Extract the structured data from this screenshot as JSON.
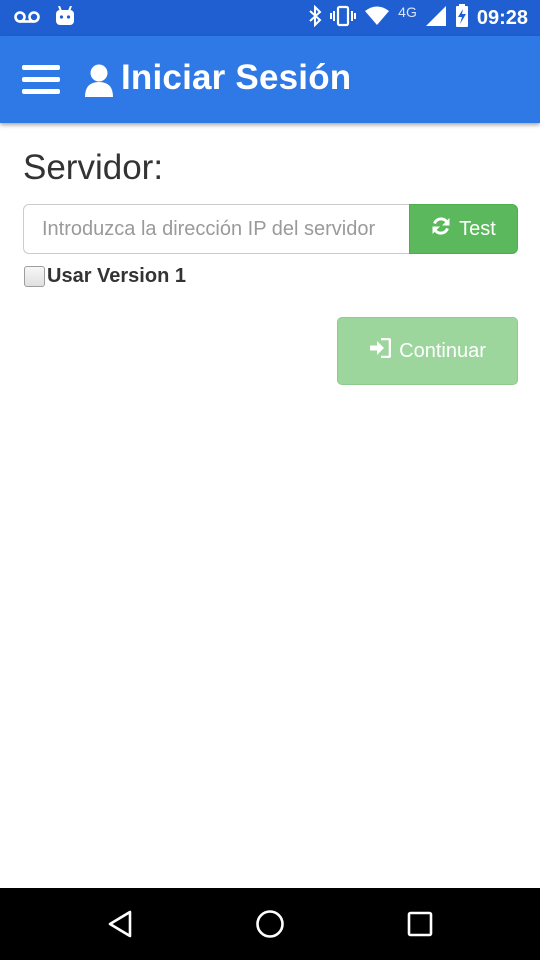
{
  "status_bar": {
    "network_label": "4G",
    "time": "09:28",
    "icons": [
      "voicemail-icon",
      "android-debug-icon",
      "bluetooth-icon",
      "vibrate-icon",
      "wifi-icon",
      "signal-icon",
      "battery-charging-icon"
    ]
  },
  "app_bar": {
    "title": "Iniciar Sesión",
    "menu_icon": "hamburger-menu-icon",
    "title_icon": "user-icon",
    "background_color": "#2f79e6"
  },
  "form": {
    "server_label": "Servidor:",
    "ip_input": {
      "value": "",
      "placeholder": "Introduzca la dirección IP del servidor"
    },
    "test_button_label": "Test",
    "test_button_icon": "refresh-icon",
    "test_button_color": "#5cb85c",
    "version_checkbox": {
      "label": "Usar Version 1",
      "checked": false
    },
    "continue_button_label": "Continuar",
    "continue_button_icon": "sign-in-icon",
    "continue_button_color": "#9dd69d"
  },
  "nav_bar": {
    "buttons": [
      "back-icon",
      "home-icon",
      "recents-icon"
    ]
  }
}
